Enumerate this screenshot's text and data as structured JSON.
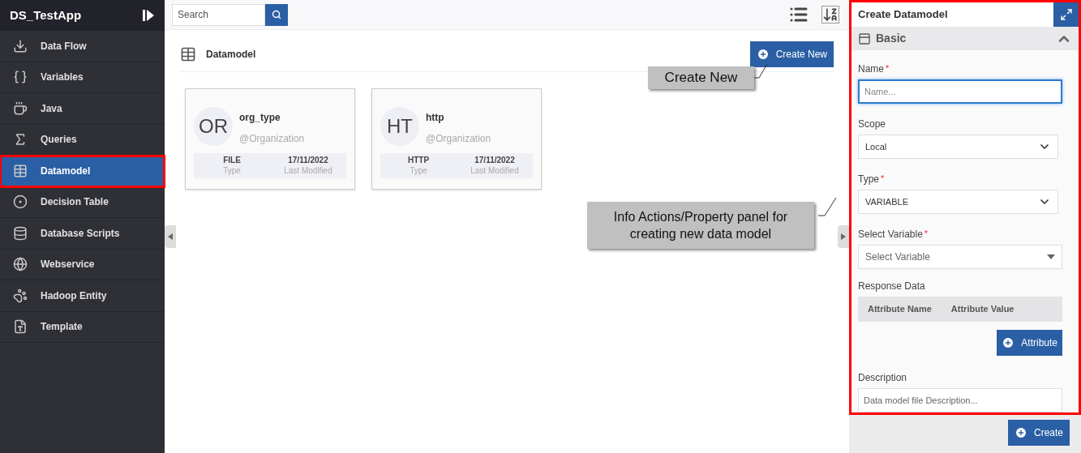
{
  "app": {
    "title": "DS_TestApp"
  },
  "sidebar": {
    "items": [
      {
        "label": "Data Flow",
        "selected": false
      },
      {
        "label": "Variables",
        "selected": false
      },
      {
        "label": "Java",
        "selected": false
      },
      {
        "label": "Queries",
        "selected": false
      },
      {
        "label": "Datamodel",
        "selected": true
      },
      {
        "label": "Decision Table",
        "selected": false
      },
      {
        "label": "Database Scripts",
        "selected": false
      },
      {
        "label": "Webservice",
        "selected": false
      },
      {
        "label": "Hadoop Entity",
        "selected": false
      },
      {
        "label": "Template",
        "selected": false
      }
    ]
  },
  "toolbar": {
    "search": {
      "placeholder": "Search"
    }
  },
  "section": {
    "title": "Datamodel",
    "create_button": "Create New"
  },
  "cards": [
    {
      "initials": "OR",
      "name": "org_type",
      "owner": "@Organization",
      "type": "FILE",
      "type_label": "Type",
      "date": "17/11/2022",
      "date_label": "Last Modified"
    },
    {
      "initials": "HT",
      "name": "http",
      "owner": "@Organization",
      "type": "HTTP",
      "type_label": "Type",
      "date": "17/11/2022",
      "date_label": "Last Modified"
    }
  ],
  "callouts": [
    {
      "text": "Create New"
    },
    {
      "text": "Info Actions/Property panel for creating new data model"
    }
  ],
  "panel": {
    "title": "Create Datamodel",
    "section": "Basic",
    "expanded": true,
    "fields": [
      {
        "kind": "input",
        "label": "Name",
        "required_mark": "*",
        "placeholder": "Name...",
        "focused": true
      },
      {
        "kind": "select",
        "label": "Scope",
        "value": "Local"
      },
      {
        "kind": "select",
        "label": "Type",
        "required_mark": "*",
        "value": "VARIABLE"
      },
      {
        "kind": "combo",
        "label": "Select Variable",
        "required_mark": "*",
        "placeholder": "Select Variable"
      }
    ],
    "response": {
      "label": "Response Data",
      "columns": [
        "Attribute Name",
        "Attribute Value"
      ],
      "add_button": "Attribute"
    },
    "description": {
      "label": "Description",
      "placeholder": "Data model file Description..."
    },
    "submit": "Create"
  }
}
